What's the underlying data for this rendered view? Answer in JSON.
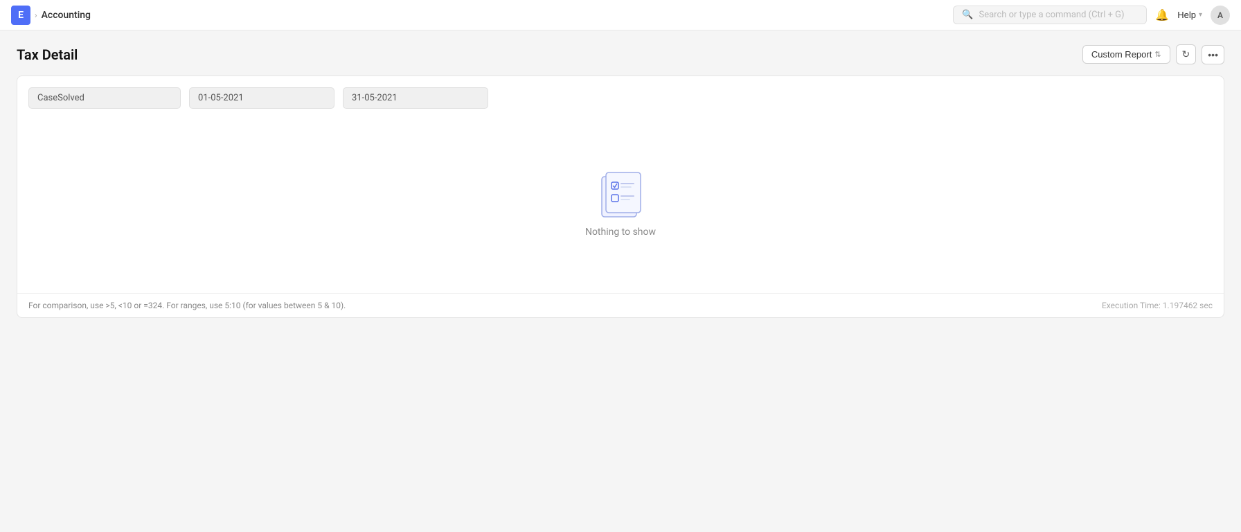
{
  "topnav": {
    "logo_letter": "E",
    "breadcrumb_separator": "›",
    "page_name": "Accounting",
    "search_placeholder": "Search or type a command (Ctrl + G)",
    "help_label": "Help",
    "avatar_initial": "A"
  },
  "page": {
    "title": "Tax Detail",
    "custom_report_label": "Custom Report",
    "refresh_icon": "↻",
    "more_icon": "···"
  },
  "filters": {
    "company_value": "CaseSolved",
    "date_from": "01-05-2021",
    "date_to": "31-05-2021"
  },
  "empty_state": {
    "message": "Nothing to show"
  },
  "footer": {
    "hint": "For comparison, use >5, <10 or =324. For ranges, use 5:10 (for values between 5 & 10).",
    "execution_time": "Execution Time: 1.197462 sec"
  }
}
